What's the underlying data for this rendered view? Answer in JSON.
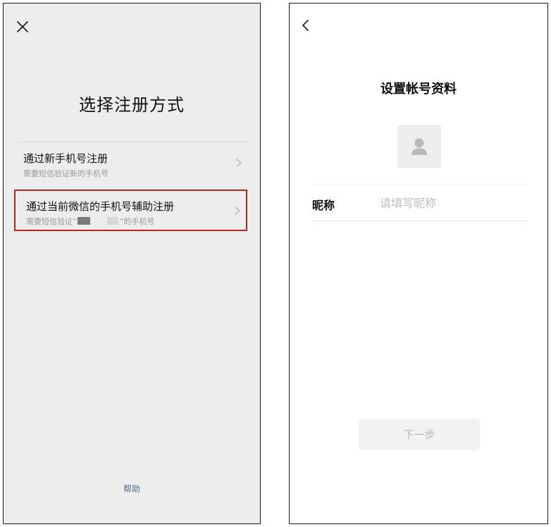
{
  "left_screen": {
    "close_icon": "close-icon",
    "title": "选择注册方式",
    "options": [
      {
        "title": "通过新手机号注册",
        "subtitle": "需要短信验证新的手机号",
        "icon": "chevron-right-icon"
      },
      {
        "title": "通过当前微信的手机号辅助注册",
        "subtitle_prefix": "需要短信验证“",
        "subtitle_suffix": "”的手机号",
        "icon": "chevron-right-icon",
        "highlight_color": "#b3281c"
      }
    ],
    "help_label": "帮助",
    "background": "#ededed"
  },
  "right_screen": {
    "back_icon": "chevron-left-icon",
    "title": "设置帐号资料",
    "avatar_icon": "person-icon",
    "nickname": {
      "label": "昵称",
      "value": "",
      "placeholder": "请填写昵称"
    },
    "next_button_label": "下一步"
  },
  "colors": {
    "link": "#576b95",
    "highlight": "#b3281c",
    "placeholder": "#bdbdbd"
  }
}
